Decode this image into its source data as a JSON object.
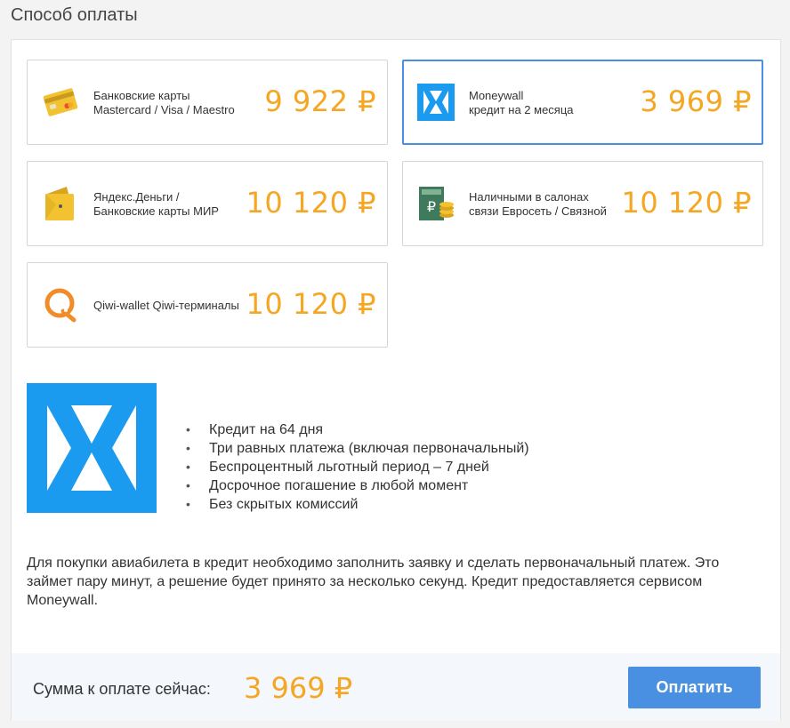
{
  "title": "Способ оплаты",
  "colors": {
    "accent": "#f5a623",
    "primary": "#4a90e2",
    "moneywall": "#1a9bf0"
  },
  "options": [
    {
      "icon": "bank-card-icon",
      "label_line1": "Банковские карты",
      "label_line2": "Mastercard / Visa / Maestro",
      "price": "9 922 ₽",
      "selected": false
    },
    {
      "icon": "moneywall-logo-icon",
      "label_line1": "Moneywall",
      "label_line2": "кредит на 2 месяца",
      "price": "3 969 ₽",
      "selected": true
    },
    {
      "icon": "yandex-wallet-icon",
      "label_line1": "Яндекс.Деньги /",
      "label_line2": "Банковские карты МИР",
      "price": "10 120 ₽",
      "selected": false
    },
    {
      "icon": "cash-coins-icon",
      "label_line1": "Наличными в салонах",
      "label_line2": "связи Евросеть / Связной",
      "price": "10 120 ₽",
      "selected": false
    },
    {
      "icon": "qiwi-icon",
      "label_line1": "Qiwi-wallet Qiwi-терминалы",
      "label_line2": "",
      "price": "10 120 ₽",
      "selected": false
    }
  ],
  "features": [
    "Кредит на 64 дня",
    "Три равных платежа (включая первоначальный)",
    "Беспроцентный льготный период – 7 дней",
    "Досрочное погашение в любой момент",
    "Без скрытых комиссий"
  ],
  "description": "Для покупки авиабилета в кредит необходимо заполнить заявку и сделать первоначальный платеж. Это займет пару минут, а решение будет принято за несколько секунд. Кредит предоставляется сервисом Moneywall.",
  "footer": {
    "sum_label": "Сумма к оплате сейчас:",
    "sum_value": "3 969 ₽",
    "pay_label": "Оплатить"
  }
}
